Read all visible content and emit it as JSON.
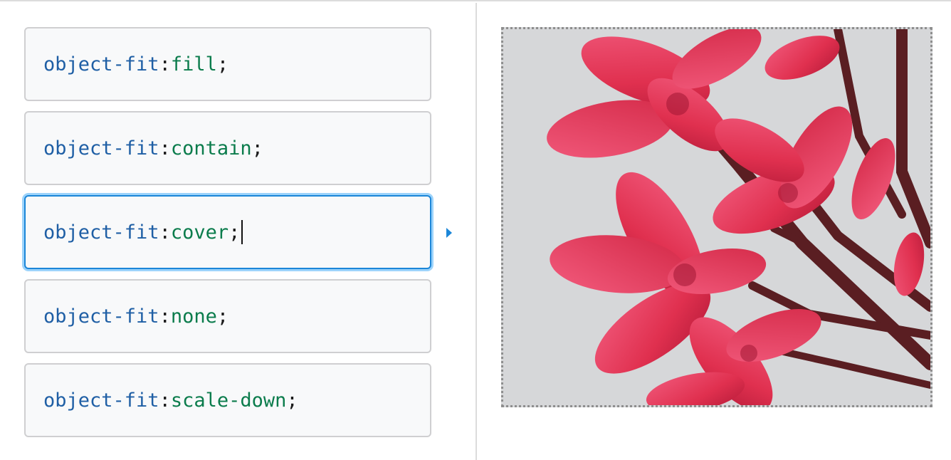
{
  "choices": [
    {
      "prop": "object-fit",
      "colon": ": ",
      "value": "fill",
      "semi": ";",
      "selected": false
    },
    {
      "prop": "object-fit",
      "colon": ": ",
      "value": "contain",
      "semi": ";",
      "selected": false
    },
    {
      "prop": "object-fit",
      "colon": ": ",
      "value": "cover",
      "semi": ";",
      "selected": true
    },
    {
      "prop": "object-fit",
      "colon": ": ",
      "value": "none",
      "semi": ";",
      "selected": false
    },
    {
      "prop": "object-fit",
      "colon": ": ",
      "value": "scale-down",
      "semi": ";",
      "selected": false
    }
  ],
  "output": {
    "image": "pink-frangipani-flowers-image"
  },
  "colors": {
    "selected_border": "#1b86d8",
    "property": "#1f5fa5",
    "value": "#0b7c4c",
    "flower": "#e0304f"
  }
}
